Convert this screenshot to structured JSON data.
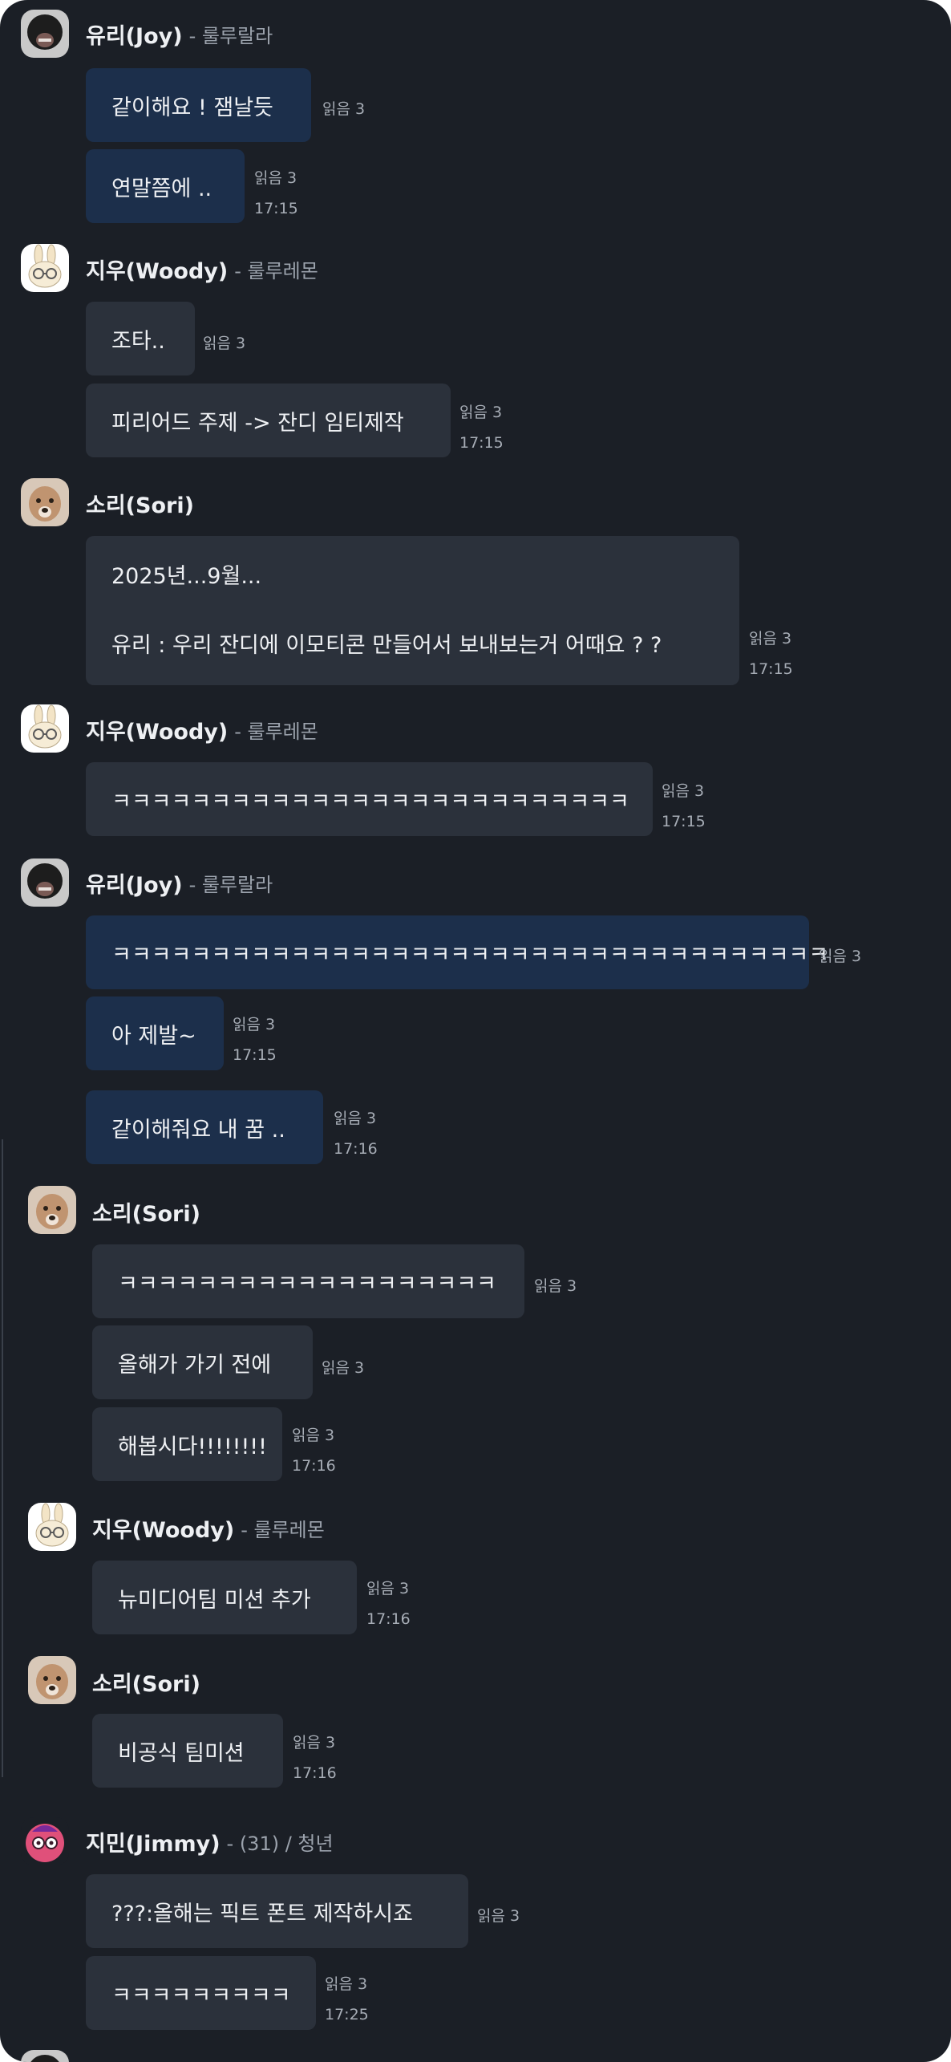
{
  "read_label": "읽음 3",
  "users": {
    "joy": {
      "name": "유리(Joy)",
      "sub": "- 룰루랄라"
    },
    "woody": {
      "name": "지우(Woody)",
      "sub": "- 룰루레몬"
    },
    "sori": {
      "name": "소리(Sori)",
      "sub": ""
    },
    "jimmy": {
      "name": "지민(Jimmy)",
      "sub": "- (31) / 청년"
    }
  },
  "messages": [
    "같이해요 ! 잼날듯",
    "연말쯤에 ..",
    "조타..",
    "피리어드 주제 -> 잔디 임티제작",
    "2025년...9월...",
    "유리 : 우리 잔디에 이모티콘 만들어서 보내보는거 어때요 ? ?",
    "ㅋㅋㅋㅋㅋㅋㅋㅋㅋㅋㅋㅋㅋㅋㅋㅋㅋㅋㅋㅋㅋㅋㅋㅋㅋㅋ",
    "ㅋㅋㅋㅋㅋㅋㅋㅋㅋㅋㅋㅋㅋㅋㅋㅋㅋㅋㅋㅋㅋㅋㅋㅋㅋㅋㅋㅋㅋㅋㅋㅋㅋㅋㅋㅋ",
    "아 제발~",
    "같이해줘요 내 꿈 ..",
    "ㅋㅋㅋㅋㅋㅋㅋㅋㅋㅋㅋㅋㅋㅋㅋㅋㅋㅋㅋ",
    "올해가 가기 전에",
    "해봅시다!!!!!!!!",
    "뉴미디어팀 미션 추가",
    "비공식 팀미션",
    "???:올해는 픽트 폰트 제작하시죠",
    "ㅋㅋㅋㅋㅋㅋㅋㅋㅋ"
  ],
  "times": [
    "17:15",
    "17:15",
    "17:15",
    "17:15",
    "17:15",
    "17:16",
    "17:16",
    "17:16",
    "17:16",
    "17:25"
  ],
  "avatars": {
    "joy": "dark-portrait",
    "woody": "bunny-with-glasses",
    "sori": "puppy-photo",
    "jimmy": "pink-character-with-glasses"
  }
}
